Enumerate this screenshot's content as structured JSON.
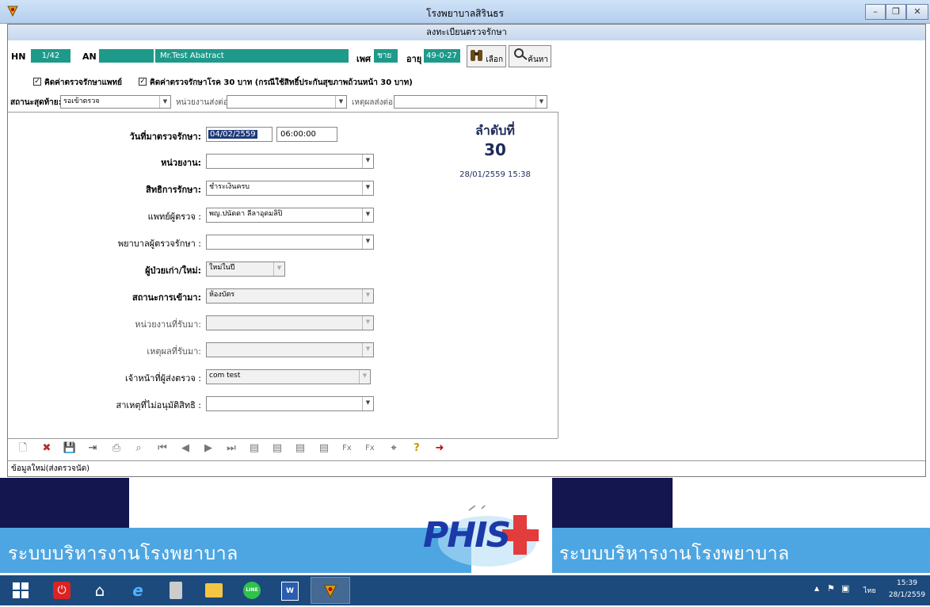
{
  "window": {
    "title": "โรงพยาบาลสิรินธร"
  },
  "form": {
    "title": "ลงทะเบียนตรวจรักษา",
    "hn_label": "HN",
    "hn": "1/42",
    "an_label": "AN",
    "an": "",
    "name": "Mr.Test Abatract",
    "sex_label": "เพศ",
    "sex": "ชาย",
    "age_label": "อายุ",
    "age": "49-0-27",
    "select_btn": "เลือก",
    "search_btn": "ค้นหา",
    "chk_doctor_fee": "คิดค่าตรวจรักษาแพทย์",
    "chk_30baht": "คิดค่าตรวจรักษาโรค 30 บาท (กรณีใช้สิทธิ์ประกันสุขภาพถ้วนหน้า 30 บาท)",
    "last_status_label": "สถานะสุดท้าย:",
    "last_status": "รอเข้าตรวจ",
    "send_unit_label": "หน่วยงานส่งต่อ:",
    "send_unit": "",
    "send_reason_label": "เหตุผลส่งต่อ:",
    "send_reason": "",
    "visit_date_label": "วันที่มาตรวจรักษา:",
    "visit_date": "04/02/2559",
    "visit_time": "06:00:00",
    "queue_label": "ลำดับที่",
    "queue_number": "30",
    "queue_datetime": "28/01/2559 15:38",
    "fields": {
      "unit_label": "หน่วยงาน:",
      "unit": "",
      "right_label": "สิทธิการรักษา:",
      "right": "ชำระเงินครบ",
      "doctor_label": "แพทย์ผู้ตรวจ :",
      "doctor": "พญ.ปนัดดา ลีลาอุดมลิปิ",
      "nurse_label": "พยาบาลผู้ตรวจรักษา :",
      "nurse": "",
      "patient_type_label": "ผู้ป่วยเก่า/ใหม่:",
      "patient_type": "ใหม่ในปี",
      "arrival_label": "สถานะการเข้ามา:",
      "arrival": "ห้องบัตร",
      "receive_unit_label": "หน่วยงานที่รับมา:",
      "receive_unit": "",
      "receive_reason_label": "เหตุผลที่รับมา:",
      "receive_reason": "",
      "officer_label": "เจ้าหน้าที่ผู้ส่งตรวจ :",
      "officer": "com test",
      "reject_reason_label": "สาเหตุที่ไม่อนุมัติสิทธิ :",
      "reject_reason": ""
    },
    "status_text": "ข้อมูลใหม่(ส่งตรวจนัด)"
  },
  "banner": {
    "text_left": "ระบบบริหารงานโรงพยาบาล",
    "logo": "PHIS",
    "text_right": "ระบบบริหารงานโรงพยาบาล"
  },
  "taskbar": {
    "lang": "ไทย",
    "time": "15:39",
    "date": "28/1/2559"
  },
  "colors": {
    "accent": "#1e9a8a",
    "banner_navy": "#14164f",
    "banner_blue": "#4da6e2",
    "taskbar": "#1c4a7c"
  }
}
